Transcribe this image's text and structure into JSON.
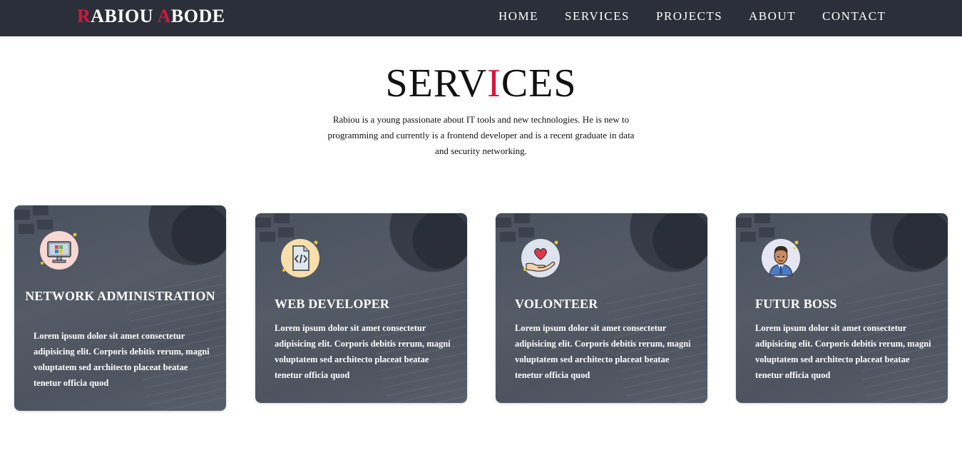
{
  "brand": {
    "first_initial": "R",
    "first_rest": "ABIOU ",
    "second_initial": "A",
    "second_rest": "BODE",
    "accent_color": "#d6163f"
  },
  "nav": {
    "items": [
      {
        "label": "HOME"
      },
      {
        "label": "SERVICES"
      },
      {
        "label": "PROJECTS"
      },
      {
        "label": "ABOUT"
      },
      {
        "label": "CONTACT"
      }
    ],
    "background": "#2a2f39"
  },
  "section": {
    "title_before": "SERV",
    "title_accent": "I",
    "title_after": "CES",
    "description": "Rabiou is a young passionate about IT tools and new technologies. He is new to programming and currently is a frontend developer and is a recent graduate in data and security networking."
  },
  "cards": [
    {
      "title": "NETWORK ADMINISTRATION",
      "icon": "computer-monitor-icon",
      "text": "Lorem ipsum dolor sit amet consectetur adipisicing elit. Corporis debitis rerum, magni voluptatem sed architecto placeat beatae tenetur officia quod"
    },
    {
      "title": "WEB DEVELOPER",
      "icon": "code-file-icon",
      "text": "Lorem ipsum dolor sit amet consectetur adipisicing elit. Corporis debitis rerum, magni voluptatem sed architecto placeat beatae tenetur officia quod"
    },
    {
      "title": "VOLONTEER",
      "icon": "heart-hand-icon",
      "text": "Lorem ipsum dolor sit amet consectetur adipisicing elit. Corporis debitis rerum, magni voluptatem sed architecto placeat beatae tenetur officia quod"
    },
    {
      "title": "FUTUR BOSS",
      "icon": "businessman-avatar-icon",
      "text": "Lorem ipsum dolor sit amet consectetur adipisicing elit. Corporis debitis rerum, magni voluptatem sed architecto placeat beatae tenetur officia quod"
    }
  ]
}
